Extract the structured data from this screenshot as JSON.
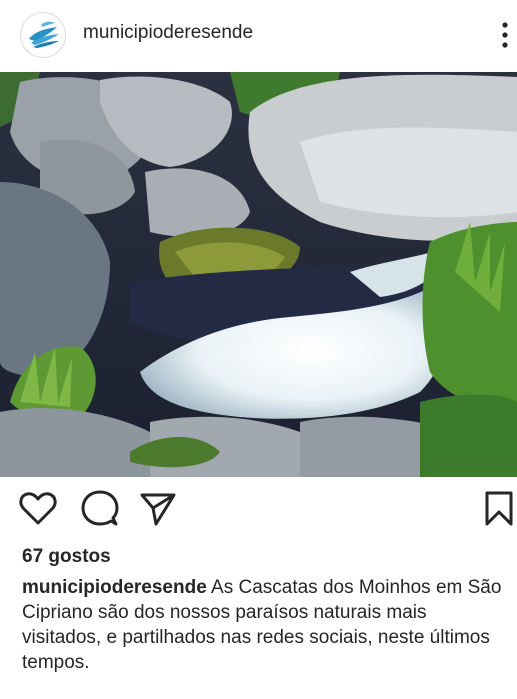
{
  "post": {
    "username": "municipioderesende",
    "likes_text": "67 gostos",
    "caption_user": "municipioderesende",
    "caption_text": "As Cascatas dos Moinhos em São Cipriano são dos nossos paraísos naturais mais visitados, e partilhados nas redes sociais, neste últimos tempos."
  },
  "icons": {
    "avatar": "municipality-logo",
    "more": "more-vertical-icon",
    "like": "heart-outline-icon",
    "comment": "comment-bubble-icon",
    "share": "send-paper-plane-icon",
    "save": "bookmark-icon"
  },
  "colors": {
    "text": "#262626",
    "icon": "#262626",
    "logo_blue": "#2a8fc4"
  }
}
